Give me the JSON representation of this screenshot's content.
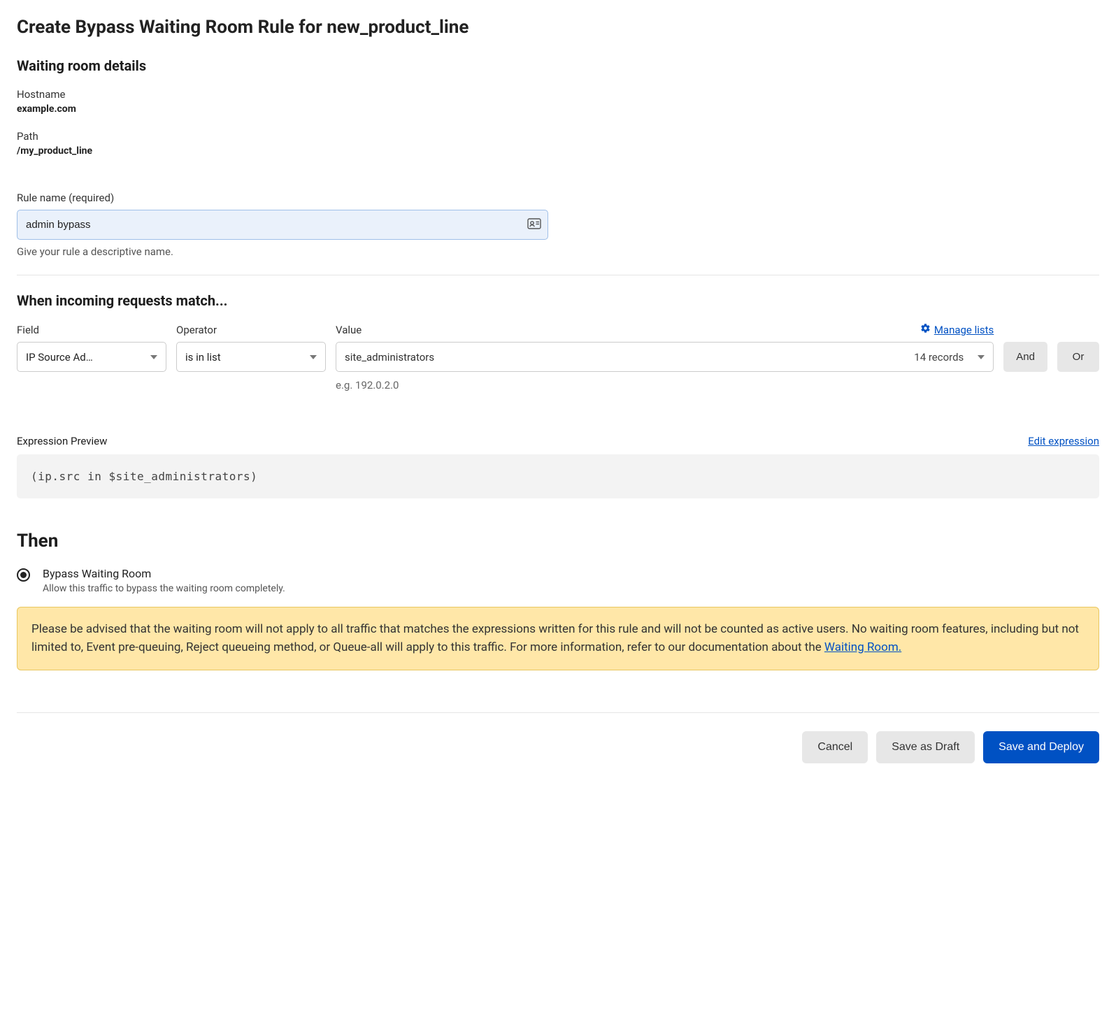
{
  "page": {
    "title": "Create Bypass Waiting Room Rule for new_product_line"
  },
  "details": {
    "heading": "Waiting room details",
    "hostname_label": "Hostname",
    "hostname_value": "example.com",
    "path_label": "Path",
    "path_value": "/my_product_line"
  },
  "rule": {
    "name_label": "Rule name (required)",
    "name_value": "admin bypass",
    "name_hint": "Give your rule a descriptive name."
  },
  "match": {
    "heading": "When incoming requests match...",
    "field_label": "Field",
    "operator_label": "Operator",
    "value_label": "Value",
    "manage_lists": "Manage lists",
    "field_selected": "IP Source Ad…",
    "operator_selected": "is in list",
    "value_entered": "site_administrators",
    "records_text": "14 records",
    "example_text": "e.g. 192.0.2.0",
    "and_label": "And",
    "or_label": "Or"
  },
  "expression": {
    "heading": "Expression Preview",
    "edit_link": "Edit expression",
    "code": "(ip.src in $site_administrators)"
  },
  "then": {
    "heading": "Then",
    "option_label": "Bypass Waiting Room",
    "option_desc": "Allow this traffic to bypass the waiting room completely.",
    "warning_pre": "Please be advised that the waiting room will not apply to all traffic that matches the expressions written for this rule and will not be counted as active users. No waiting room features, including but not limited to, Event pre-queuing, Reject queueing method, or Queue-all will apply to this traffic. For more information, refer to our documentation about the ",
    "warning_link": "Waiting Room."
  },
  "footer": {
    "cancel": "Cancel",
    "draft": "Save as Draft",
    "deploy": "Save and Deploy"
  }
}
